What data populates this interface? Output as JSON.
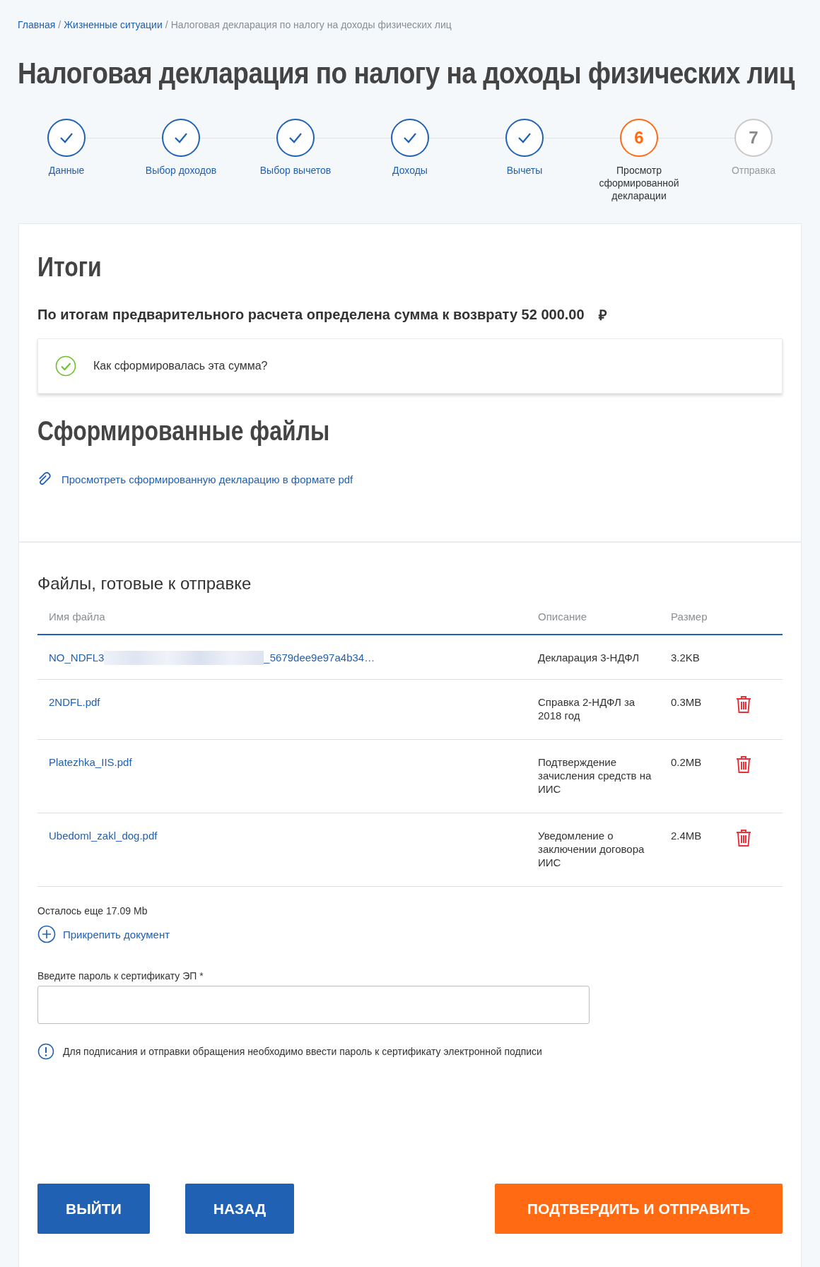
{
  "breadcrumb": [
    {
      "label": "Главная",
      "link": true
    },
    {
      "separator": "/",
      "label": "Жизненные ситуации",
      "link": true
    },
    {
      "separator": "/",
      "label": "Налоговая декларация по налогу на доходы физических лиц",
      "link": false
    }
  ],
  "title": "Налоговая декларация по налогу на доходы физических лиц",
  "steps": [
    {
      "label": "Данные",
      "kind": "done"
    },
    {
      "label": "Выбор доходов",
      "kind": "done"
    },
    {
      "label": "Выбор вычетов",
      "kind": "done"
    },
    {
      "label": "Доходы",
      "kind": "done"
    },
    {
      "label": "Вычеты",
      "kind": "done"
    },
    {
      "label": "Просмотр сформированной декларации",
      "number": "6",
      "kind": "current"
    },
    {
      "label": "Отправка",
      "number": "7",
      "kind": "pending"
    }
  ],
  "summary": {
    "heading": "Итоги",
    "amount_text": "По итогам предварительного расчета определена сумма к возврату 52 000.00",
    "currency": "₽",
    "explain": "Как сформировалась эта сумма?"
  },
  "generated": {
    "heading": "Сформированные файлы",
    "link": "Просмотреть сформированную декларацию в формате pdf"
  },
  "files": {
    "heading": "Файлы, готовые к отправке",
    "columns": [
      "Имя файла",
      "Описание",
      "Размер"
    ],
    "rows": [
      {
        "name": "NO_NDFL3",
        "name_end": "_5679dee9e97a4b34…",
        "redacted": true,
        "description": "Декларация 3-НДФЛ",
        "size": "3.2KB",
        "deletable": false
      },
      {
        "name": "2NDFL.pdf",
        "redacted": false,
        "description": "Справка 2-НДФЛ за 2018 год",
        "size": "0.3MB",
        "deletable": true
      },
      {
        "name": "Platezhka_IIS.pdf",
        "redacted": false,
        "description": "Подтверждение зачисления средств на ИИС",
        "size": "0.2MB",
        "deletable": true
      },
      {
        "name": "Ubedoml_zakl_dog.pdf",
        "redacted": false,
        "description": "Уведомление о заключении договора ИИС",
        "size": "2.4MB",
        "deletable": true
      }
    ],
    "remaining": "Осталось еще 17.09 Mb",
    "attach": "Прикрепить документ"
  },
  "password": {
    "label": "Введите пароль к сертификату ЭП *",
    "hint": "Для подписания и отправки обращения необходимо ввести пароль к сертификату электронной подписи"
  },
  "buttons": [
    {
      "label": "ВЫЙТИ",
      "kind": "primary"
    },
    {
      "label": "НАЗАД",
      "kind": "primary"
    },
    {
      "label": "ПОДТВЕРДИТЬ И ОТПРАВИТЬ",
      "kind": "accent"
    }
  ]
}
